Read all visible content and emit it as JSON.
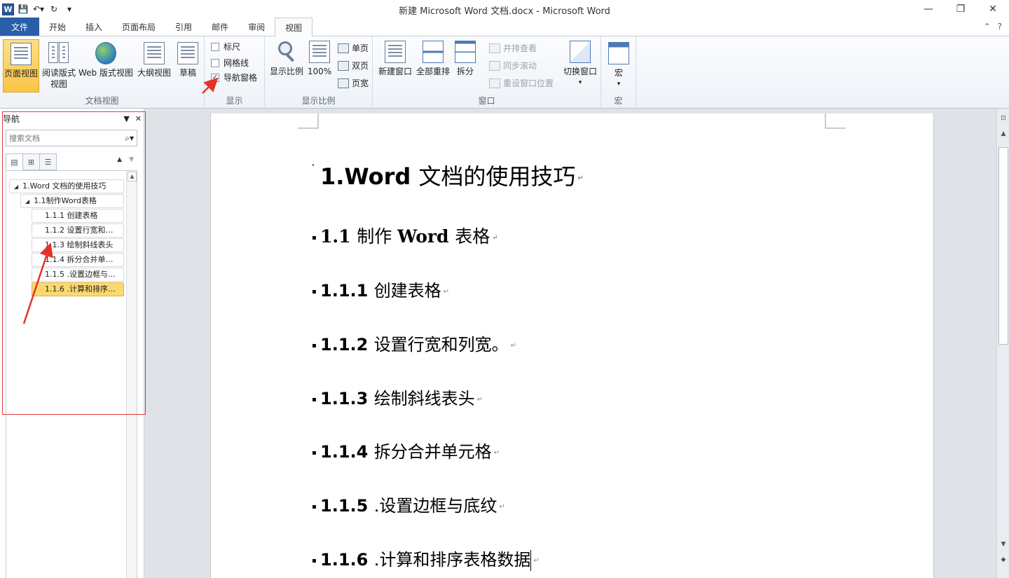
{
  "window": {
    "title": "新建 Microsoft Word 文档.docx - Microsoft Word",
    "logo": "W",
    "minimize": "—",
    "restore": "❐",
    "close": "✕"
  },
  "qat": {
    "save": "💾",
    "undo": "↶▾",
    "redo": "↻",
    "customize": "▾"
  },
  "tabs": [
    {
      "label": "文件"
    },
    {
      "label": "开始"
    },
    {
      "label": "插入"
    },
    {
      "label": "页面布局"
    },
    {
      "label": "引用"
    },
    {
      "label": "邮件"
    },
    {
      "label": "审阅"
    },
    {
      "label": "视图"
    }
  ],
  "ribbon": {
    "doc_views": {
      "label": "文档视图",
      "print_layout": "页面视图",
      "reading_l1": "阅读版式",
      "reading_l2": "视图",
      "web": "Web 版式视图",
      "outline": "大纲视图",
      "draft": "草稿"
    },
    "show": {
      "label": "显示",
      "ruler": "标尺",
      "gridlines": "网格线",
      "nav_pane": "导航窗格",
      "nav_checked": "✓"
    },
    "zoom": {
      "label": "显示比例",
      "zoom": "显示比例",
      "hundred": "100%",
      "one_page": "单页",
      "two_pages": "双页",
      "page_width": "页宽"
    },
    "window": {
      "label": "窗口",
      "new_window": "新建窗口",
      "arrange_all": "全部重排",
      "split": "拆分",
      "side_by_side": "并排查看",
      "sync_scroll": "同步滚动",
      "reset_pos": "重设窗口位置",
      "switch": "切换窗口",
      "dropdown": "▾"
    },
    "macros": {
      "label": "宏",
      "macros": "宏",
      "dropdown": "▾"
    }
  },
  "nav": {
    "title": "导航",
    "search_placeholder": "搜索文档",
    "items": [
      {
        "text": "1.Word 文档的使用技巧",
        "tri": "◢"
      },
      {
        "text": "1.1制作Word表格",
        "tri": "◢"
      },
      {
        "text": "1.1.1 创建表格"
      },
      {
        "text": "1.1.2 设置行宽和…"
      },
      {
        "text": "1.1.3 绘制斜线表头"
      },
      {
        "text": "1.1.4 拆分合并单…"
      },
      {
        "text": "1.1.5 .设置边框与…"
      },
      {
        "text": "1.1.6 .计算和排序…"
      }
    ]
  },
  "document": {
    "h1": {
      "num": "1.Word ",
      "text": "文档的使用技巧"
    },
    "h2": {
      "num": "1.1 ",
      "cn": "制作 ",
      "word": "Word ",
      "cn2": "表格"
    },
    "h3": [
      {
        "num": "1.1.1 ",
        "text": "创建表格"
      },
      {
        "num": "1.1.2 ",
        "text": "设置行宽和列宽。"
      },
      {
        "num": "1.1.3 ",
        "text": "绘制斜线表头"
      },
      {
        "num": "1.1.4 ",
        "text": "拆分合并单元格"
      },
      {
        "num": "1.1.5 ",
        "text": ".设置边框与底纹"
      },
      {
        "num": "1.1.6 ",
        "text": ".计算和排序表格数据"
      }
    ],
    "para_mark": "↵",
    "bullet": "▪"
  }
}
